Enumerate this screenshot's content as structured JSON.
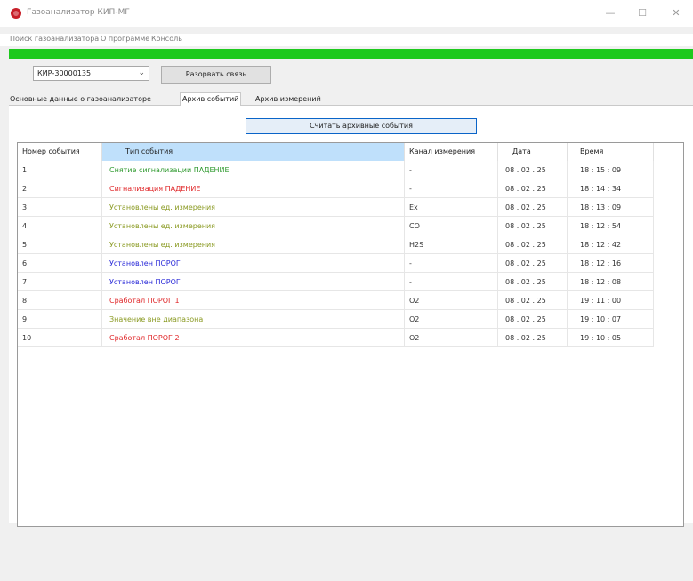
{
  "window": {
    "title": "Газоанализатор КИП-МГ",
    "controls": [
      "—",
      "☐",
      "✕"
    ]
  },
  "menu": {
    "items": [
      "Поиск газоанализатора",
      "О программе",
      "Консоль"
    ]
  },
  "toolbar": {
    "port_value": "КИР-30000135",
    "disconnect_label": "Разорвать связь"
  },
  "tabs": [
    {
      "label": "Основные данные о газоанализаторе",
      "active": false
    },
    {
      "label": "Архив событий",
      "active": true
    },
    {
      "label": "Архив измерений",
      "active": false
    }
  ],
  "archive": {
    "read_button_label": "Считать архивные события",
    "columns": [
      "Номер события",
      "Тип события",
      "Канал измерения",
      "Дата",
      "Время"
    ],
    "rows": [
      {
        "num": "1",
        "type": "Снятие сигнализации ПАДЕНИЕ",
        "type_color": "#2f9a2f",
        "channel": "-",
        "date": "08 . 02 . 25",
        "time": "18 : 15 : 09"
      },
      {
        "num": "2",
        "type": "Сигнализация ПАДЕНИЕ",
        "type_color": "#e0282a",
        "channel": "-",
        "date": "08 . 02 . 25",
        "time": "18 : 14 : 34"
      },
      {
        "num": "3",
        "type": "Установлены ед. измерения",
        "type_color": "#8a9a22",
        "channel": "Ex",
        "date": "08 . 02 . 25",
        "time": "18 : 13 : 09"
      },
      {
        "num": "4",
        "type": "Установлены ед. измерения",
        "type_color": "#8a9a22",
        "channel": "CO",
        "date": "08 . 02 . 25",
        "time": "18 : 12 : 54"
      },
      {
        "num": "5",
        "type": "Установлены ед. измерения",
        "type_color": "#8a9a22",
        "channel": "H2S",
        "date": "08 . 02 . 25",
        "time": "18 : 12 : 42"
      },
      {
        "num": "6",
        "type": "Установлен ПОРОГ",
        "type_color": "#2a2ad8",
        "channel": "-",
        "date": "08 . 02 . 25",
        "time": "18 : 12 : 16"
      },
      {
        "num": "7",
        "type": "Установлен ПОРОГ",
        "type_color": "#2a2ad8",
        "channel": "-",
        "date": "08 . 02 . 25",
        "time": "18 : 12 : 08"
      },
      {
        "num": "8",
        "type": "Сработал ПОРОГ 1",
        "type_color": "#e0282a",
        "channel": "O2",
        "date": "08 . 02 . 25",
        "time": "19 : 11 : 00"
      },
      {
        "num": "9",
        "type": "Значение вне диапазона",
        "type_color": "#8a9a22",
        "channel": "O2",
        "date": "08 . 02 . 25",
        "time": "19 : 10 : 07"
      },
      {
        "num": "10",
        "type": "Сработал ПОРОГ 2",
        "type_color": "#e0282a",
        "channel": "O2",
        "date": "08 . 02 . 25",
        "time": "19 : 10 : 05"
      }
    ]
  },
  "colors": {
    "status_green": "#1dc91d",
    "header_selected": "#bfe0fb",
    "button_focus_border": "#0a64c8"
  }
}
